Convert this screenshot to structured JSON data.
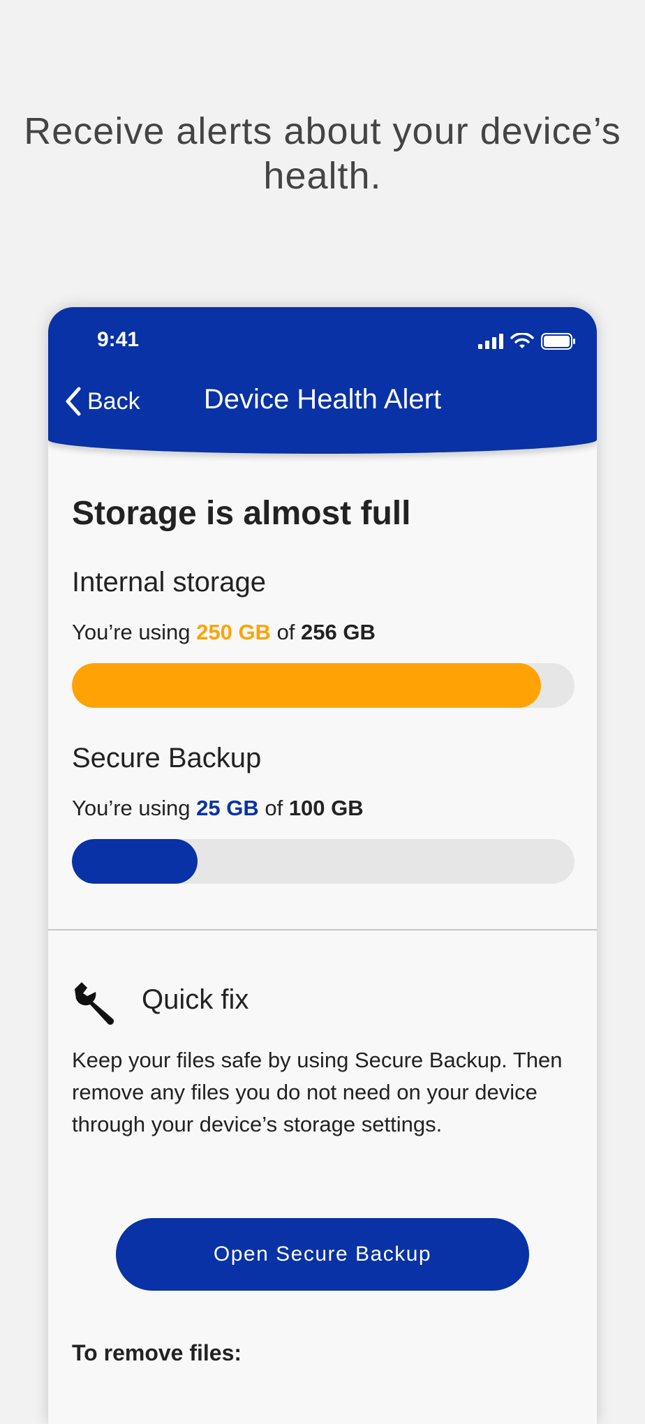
{
  "headline": "Receive alerts about your device’s health.",
  "status": {
    "time": "9:41"
  },
  "nav": {
    "back_label": "Back",
    "title": "Device Health Alert"
  },
  "alert_title": "Storage is almost full",
  "internal": {
    "title": "Internal storage",
    "prefix": "You’re using ",
    "used": "250 GB",
    "of": " of ",
    "total": "256 GB",
    "fill_fraction": 0.933,
    "color": "#ffa305"
  },
  "backup": {
    "title": "Secure Backup",
    "prefix": "You’re using ",
    "used": "25 GB",
    "of": " of ",
    "total": "100 GB",
    "fill_fraction": 0.25,
    "color": "#0832a5"
  },
  "quick_fix": {
    "icon": "wrench-icon",
    "title": "Quick fix",
    "body": "Keep your files safe by using Secure Backup. Then remove any files you do not need on your device through your device’s storage settings."
  },
  "cta_label": "Open Secure Backup",
  "remove_title": "To remove files:",
  "colors": {
    "brand": "#0832a5",
    "warning": "#ffa305",
    "background": "#f2f2f2"
  }
}
